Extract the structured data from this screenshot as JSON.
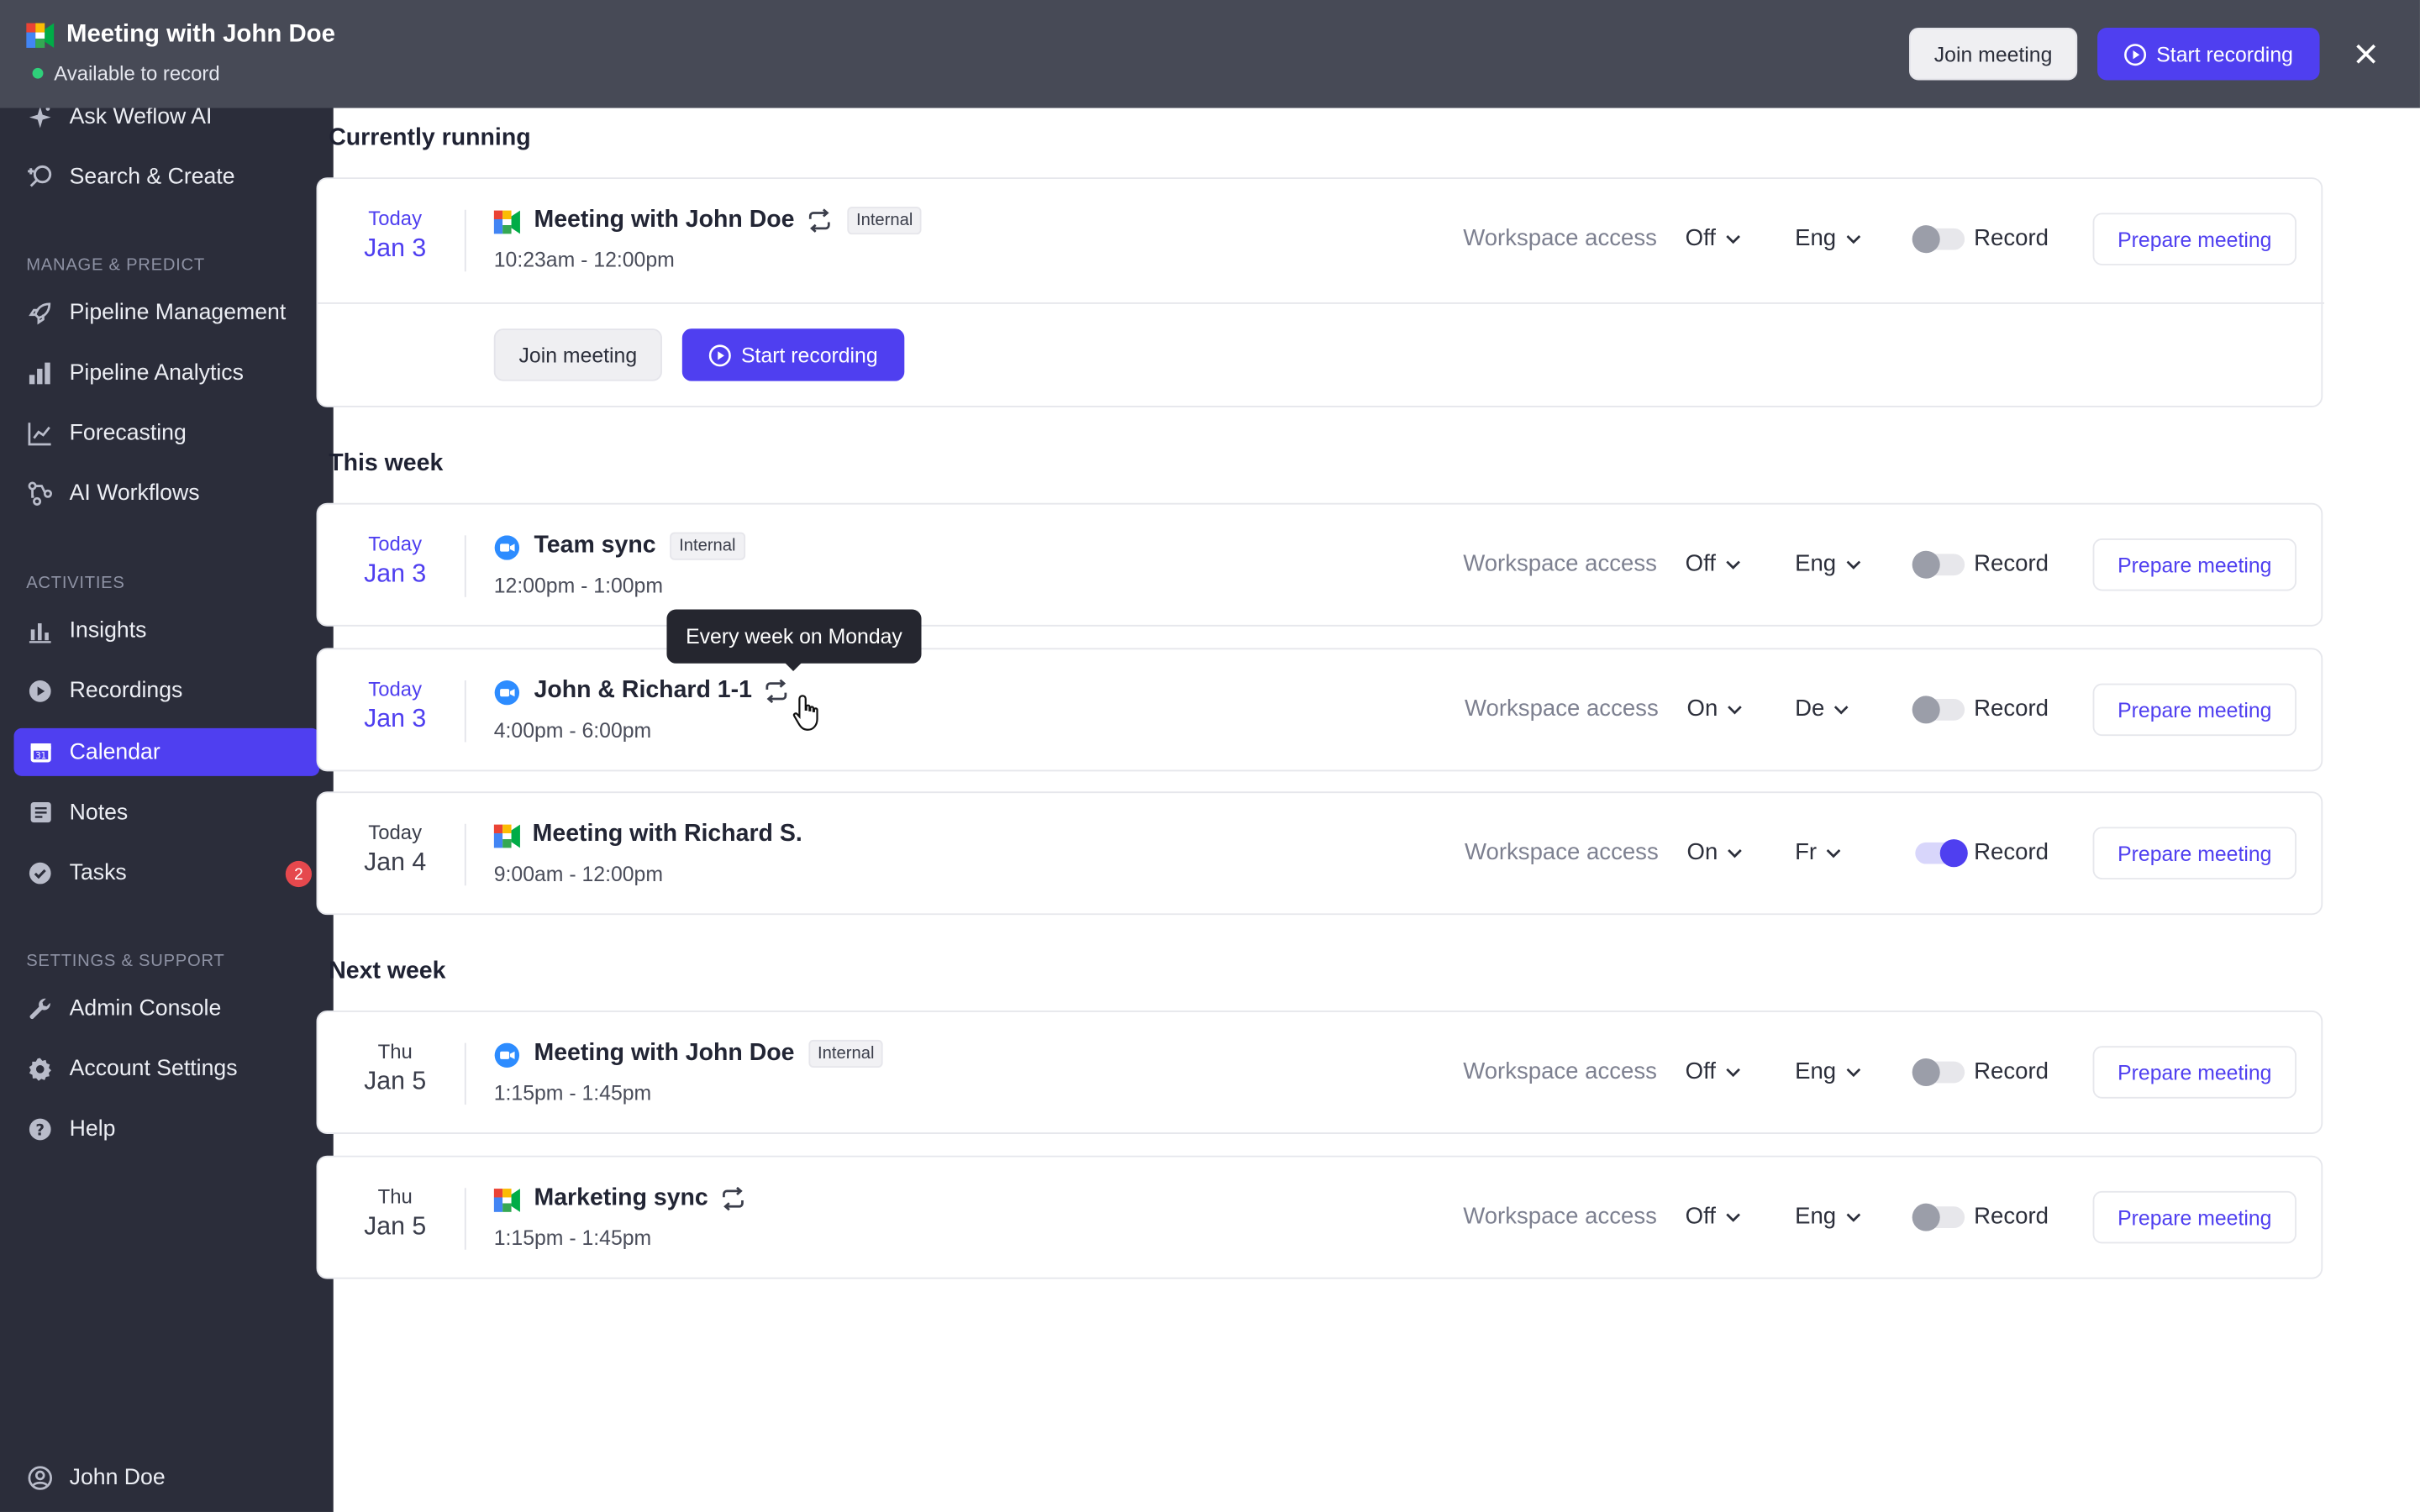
{
  "topbar": {
    "title": "Meeting with John Doe",
    "status": "Available to record",
    "join_label": "Join meeting",
    "start_label": "Start recording"
  },
  "sidebar": {
    "top_items": [
      {
        "label": "Ask Weflow AI",
        "icon": "sparkle-icon"
      },
      {
        "label": "Search & Create",
        "icon": "search-plus-icon"
      }
    ],
    "sections": [
      {
        "label": "MANAGE & PREDICT",
        "items": [
          {
            "label": "Pipeline Management",
            "icon": "rocket-icon"
          },
          {
            "label": "Pipeline Analytics",
            "icon": "bar-chart-icon"
          },
          {
            "label": "Forecasting",
            "icon": "trend-chart-icon"
          },
          {
            "label": "AI Workflows",
            "icon": "workflow-icon"
          }
        ]
      },
      {
        "label": "ACTIVITIES",
        "items": [
          {
            "label": "Insights",
            "icon": "insights-icon"
          },
          {
            "label": "Recordings",
            "icon": "play-circle-icon"
          },
          {
            "label": "Calendar",
            "icon": "calendar-icon"
          },
          {
            "label": "Notes",
            "icon": "notes-icon"
          },
          {
            "label": "Tasks",
            "icon": "check-circle-icon",
            "badge": "2"
          }
        ]
      },
      {
        "label": "SETTINGS & SUPPORT",
        "items": [
          {
            "label": "Admin Console",
            "icon": "wrench-icon"
          },
          {
            "label": "Account Settings",
            "icon": "gear-icon"
          },
          {
            "label": "Help",
            "icon": "help-icon"
          }
        ]
      }
    ],
    "user": {
      "label": "John Doe",
      "icon": "user-circle-icon"
    }
  },
  "main": {
    "groups": [
      {
        "title": "Currently running"
      },
      {
        "title": "This week"
      },
      {
        "title": "Next week"
      }
    ],
    "meetings": [
      {
        "day": "Today",
        "date": "Jan 3",
        "title": "Meeting with John Doe",
        "provider": "google-meet-icon",
        "recurring": true,
        "tag": "Internal",
        "time": "10:23am - 12:00pm",
        "workspace_label": "Workspace access",
        "access": "Off",
        "lang": "Eng",
        "record": false,
        "record_label": "Record",
        "prepare_label": "Prepare meeting",
        "join_label": "Join meeting",
        "start_label": "Start recording"
      },
      {
        "day": "Today",
        "date": "Jan 3",
        "title": "Team sync",
        "provider": "zoom-icon",
        "recurring": false,
        "tag": "Internal",
        "time": "12:00pm - 1:00pm",
        "workspace_label": "Workspace access",
        "access": "Off",
        "lang": "Eng",
        "record": false,
        "record_label": "Record",
        "prepare_label": "Prepare meeting"
      },
      {
        "day": "Today",
        "date": "Jan 3",
        "title": "John & Richard 1-1",
        "provider": "zoom-icon",
        "recurring": true,
        "tag": "",
        "time": "4:00pm - 6:00pm",
        "workspace_label": "Workspace access",
        "access": "On",
        "lang": "De",
        "record": false,
        "record_label": "Record",
        "prepare_label": "Prepare meeting"
      },
      {
        "day": "Today",
        "date": "Jan 4",
        "title": "Meeting with Richard S.",
        "provider": "google-meet-icon",
        "recurring": false,
        "tag": "",
        "time": "9:00am - 12:00pm",
        "workspace_label": "Workspace access",
        "access": "On",
        "lang": "Fr",
        "record": true,
        "record_label": "Record",
        "prepare_label": "Prepare meeting"
      },
      {
        "day": "Thu",
        "date": "Jan 5",
        "title": "Meeting with John Doe",
        "provider": "zoom-icon",
        "recurring": false,
        "tag": "Internal",
        "time": "1:15pm - 1:45pm",
        "workspace_label": "Workspace access",
        "access": "Off",
        "lang": "Eng",
        "record": false,
        "record_label": "Record",
        "prepare_label": "Prepare meeting"
      },
      {
        "day": "Thu",
        "date": "Jan 5",
        "title": "Marketing sync",
        "provider": "google-meet-icon",
        "recurring": true,
        "tag": "",
        "time": "1:15pm - 1:45pm",
        "workspace_label": "Workspace access",
        "access": "Off",
        "lang": "Eng",
        "record": false,
        "record_label": "Record",
        "prepare_label": "Prepare meeting"
      }
    ],
    "tooltip": "Every week on Monday"
  },
  "colors": {
    "accent": "#4f3ff0",
    "sidebar_bg": "#2b2d3a",
    "topbar_bg": "#474a56",
    "badge": "#e5484d",
    "status_dot": "#2fd07a"
  }
}
